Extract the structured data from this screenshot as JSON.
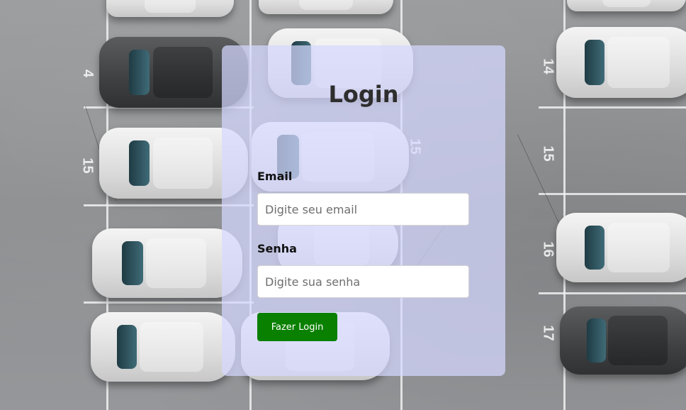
{
  "login": {
    "title": "Login",
    "email_label": "Email",
    "email_placeholder": "Digite seu email",
    "password_label": "Senha",
    "password_placeholder": "Digite sua senha",
    "submit_label": "Fazer Login"
  },
  "background": {
    "lot_numbers": [
      "4",
      "15",
      "15",
      "16",
      "17",
      "15",
      "14"
    ]
  },
  "colors": {
    "panel": "#d6d8ff",
    "button": "#0a8000",
    "title": "#2e2e2e"
  }
}
